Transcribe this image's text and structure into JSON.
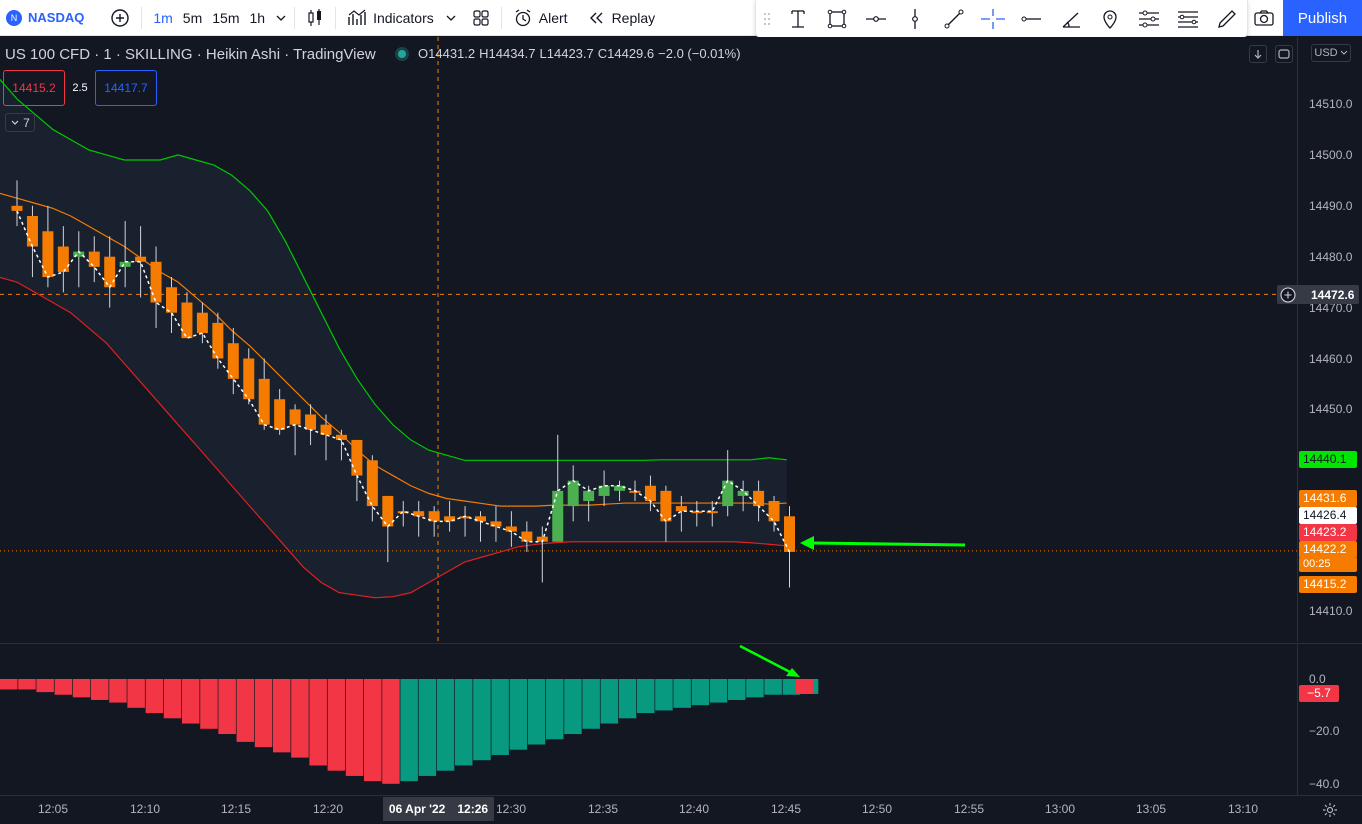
{
  "toolbar": {
    "symbol": "NASDAQ",
    "intervals": [
      "1m",
      "5m",
      "15m",
      "1h"
    ],
    "active_interval": "1m",
    "indicators_label": "Indicators",
    "alert_label": "Alert",
    "replay_label": "Replay",
    "publish_label": "Publish",
    "drawing_tools": [
      "text-cursor-icon",
      "rectangle-icon",
      "horizontal-ray-icon",
      "vertical-line-icon",
      "trend-line-icon",
      "crosshair-icon",
      "horizontal-line-icon",
      "angle-icon",
      "pin-icon",
      "settings-lines-icon",
      "hamburger-settings-icon",
      "brush-icon"
    ]
  },
  "legend": {
    "title": "US 100 CFD · 1 · SKILLING · Heikin Ashi · TradingView",
    "o_label": "O",
    "o_value": "14431.2",
    "h_label": "H",
    "h_value": "14434.7",
    "l_label": "L",
    "l_value": "14423.7",
    "c_label": "C",
    "c_value": "14429.6",
    "change": "−2.0 (−0.01%)",
    "bid": "14415.2",
    "spread": "2.5",
    "ask": "14417.7",
    "indicators_count": "7"
  },
  "price_axis": {
    "currency": "USD",
    "ticks": [
      "14510.0",
      "14500.0",
      "14490.0",
      "14480.0",
      "14470.0",
      "14460.0",
      "14450.0",
      "14410.0"
    ],
    "crosshair_price": "14472.6",
    "tags": [
      {
        "value": "14440.1",
        "bg": "#00e600",
        "fg": "#131722"
      },
      {
        "value": "14431.6",
        "bg": "#f57c00",
        "fg": "#ffffff"
      },
      {
        "value": "14426.4",
        "bg": "#ffffff",
        "fg": "#131722"
      },
      {
        "value": "14423.2",
        "bg": "#f23645",
        "fg": "#ffffff"
      },
      {
        "value": "14422.2",
        "bg": "#f57c00",
        "fg": "#ffffff"
      },
      {
        "value": "00:25",
        "bg": "#f57c00",
        "fg": "#ffffff"
      },
      {
        "value": "14415.2",
        "bg": "#f57c00",
        "fg": "#ffffff"
      }
    ]
  },
  "osc_axis": {
    "ticks": [
      "0.0",
      "−20.0",
      "−40.0"
    ],
    "current_value": "−5.7"
  },
  "time_axis": {
    "ticks": [
      "12:05",
      "12:10",
      "12:15",
      "12:20",
      "12:30",
      "12:35",
      "12:40",
      "12:45",
      "12:50",
      "12:55",
      "13:00",
      "13:05",
      "13:10"
    ],
    "crosshair_date": "06 Apr '22",
    "crosshair_time": "12:26"
  },
  "colors": {
    "bull": "#26a69a",
    "bear": "#f57c00",
    "osc_bull": "#089981",
    "osc_bear": "#f23645",
    "upper_band": "#00c800",
    "middle_band": "#f57c00",
    "lower_band": "#e02020",
    "annotation_arrow": "#00ff00"
  }
}
